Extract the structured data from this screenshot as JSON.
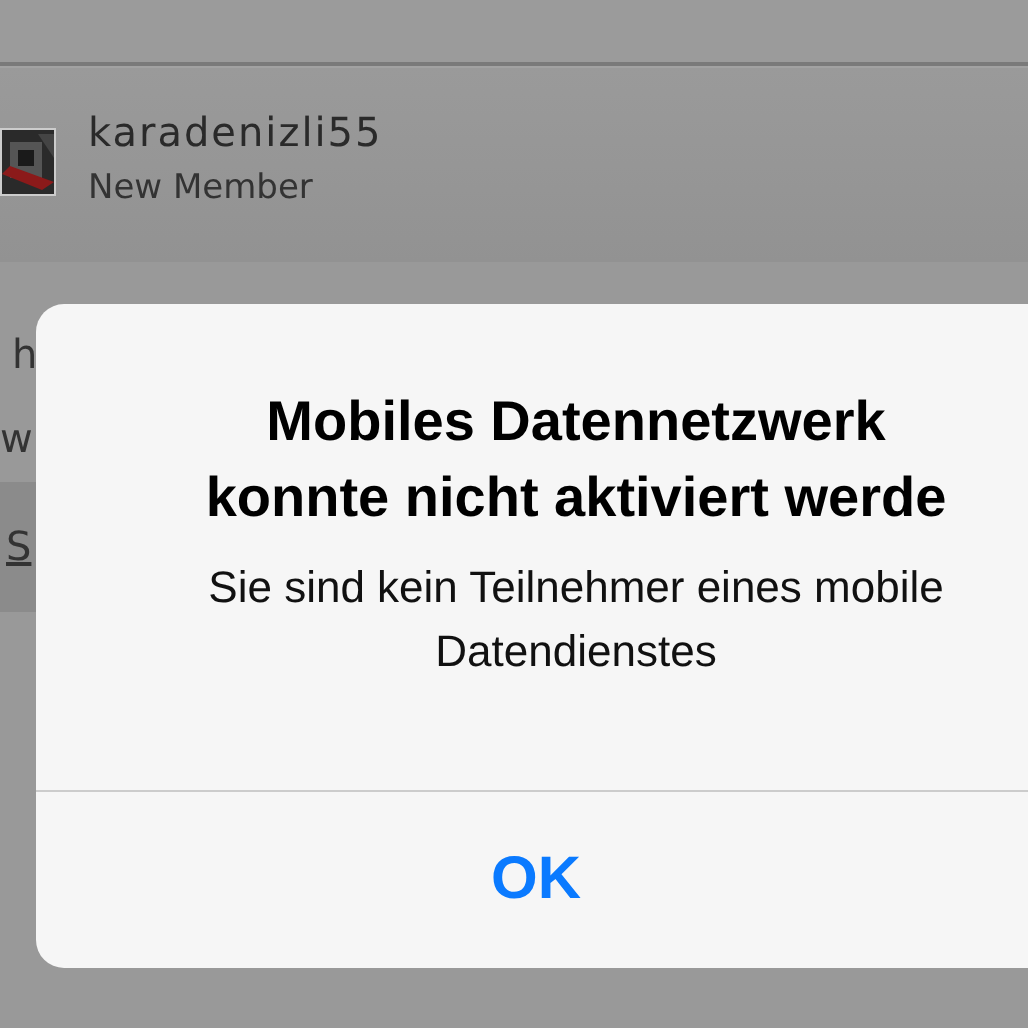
{
  "post": {
    "author": "karadenizli55",
    "rank": "New Member",
    "snippets": [
      "h",
      "w",
      "S"
    ]
  },
  "alert": {
    "title_lines": [
      "Mobiles Datennetzwerk",
      "konnte nicht aktiviert werde"
    ],
    "message_lines": [
      "Sie sind kein Teilnehmer eines mobile",
      "Datendienstes"
    ],
    "button": "OK"
  }
}
